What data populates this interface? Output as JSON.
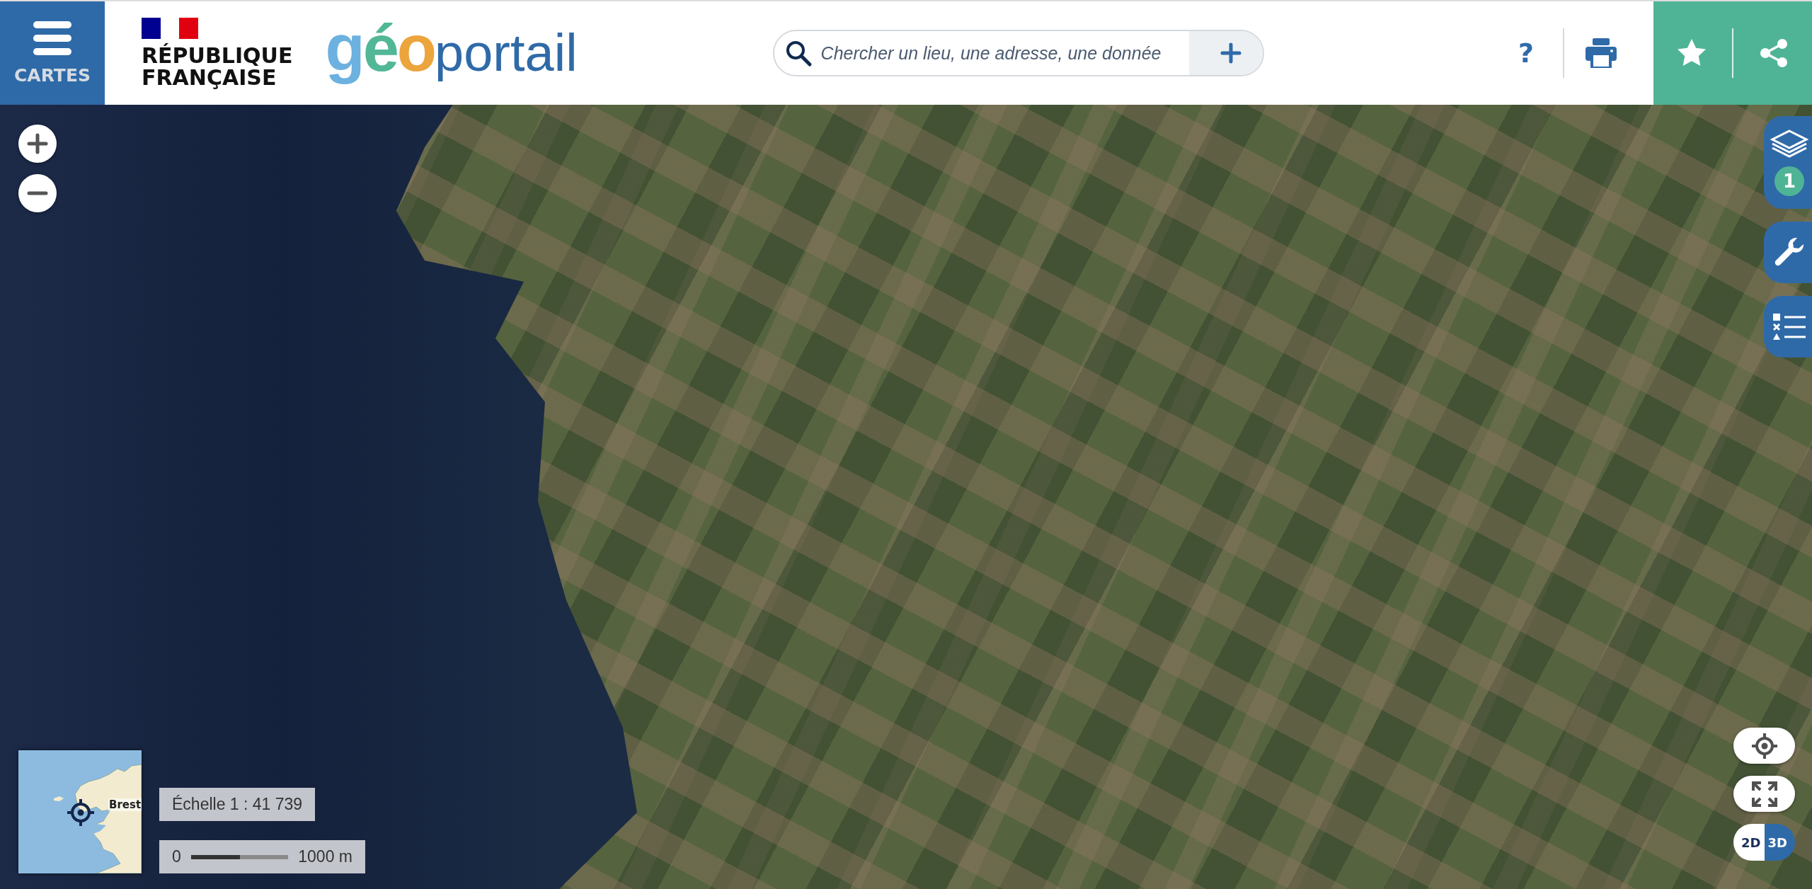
{
  "menu_button": {
    "label": "CARTES"
  },
  "brand": {
    "lines": [
      "RÉPUBLIQUE",
      "FRANÇAISE"
    ]
  },
  "logo": {
    "segments": [
      {
        "text": "g",
        "color": "#6cb1e0"
      },
      {
        "text": "é",
        "color": "#52b796"
      },
      {
        "text": "o",
        "color": "#eca43c"
      },
      {
        "text": "portail",
        "color": "#2f6aa8"
      }
    ]
  },
  "search": {
    "placeholder": "Chercher un lieu, une adresse, une donnée"
  },
  "header_actions": [
    {
      "kind": "help",
      "label": "?"
    },
    {
      "kind": "print"
    },
    {
      "kind": "favorite"
    },
    {
      "kind": "share"
    }
  ],
  "map_controls": [
    {
      "kind": "zoom_in"
    },
    {
      "kind": "zoom_out"
    }
  ],
  "side_tabs": [
    {
      "kind": "layers",
      "badge": "1"
    },
    {
      "kind": "tools"
    },
    {
      "kind": "legend"
    }
  ],
  "minimap": {
    "label": "Brest"
  },
  "scale": {
    "text": "Échelle 1 : 41 739",
    "bar_start": "0",
    "bar_end": "1000 m"
  },
  "map_tools": [
    {
      "kind": "locate"
    },
    {
      "kind": "fullscreen"
    }
  ],
  "view_toggle": [
    {
      "label": "2D",
      "selected": false
    },
    {
      "label": "3D",
      "selected": true
    }
  ]
}
